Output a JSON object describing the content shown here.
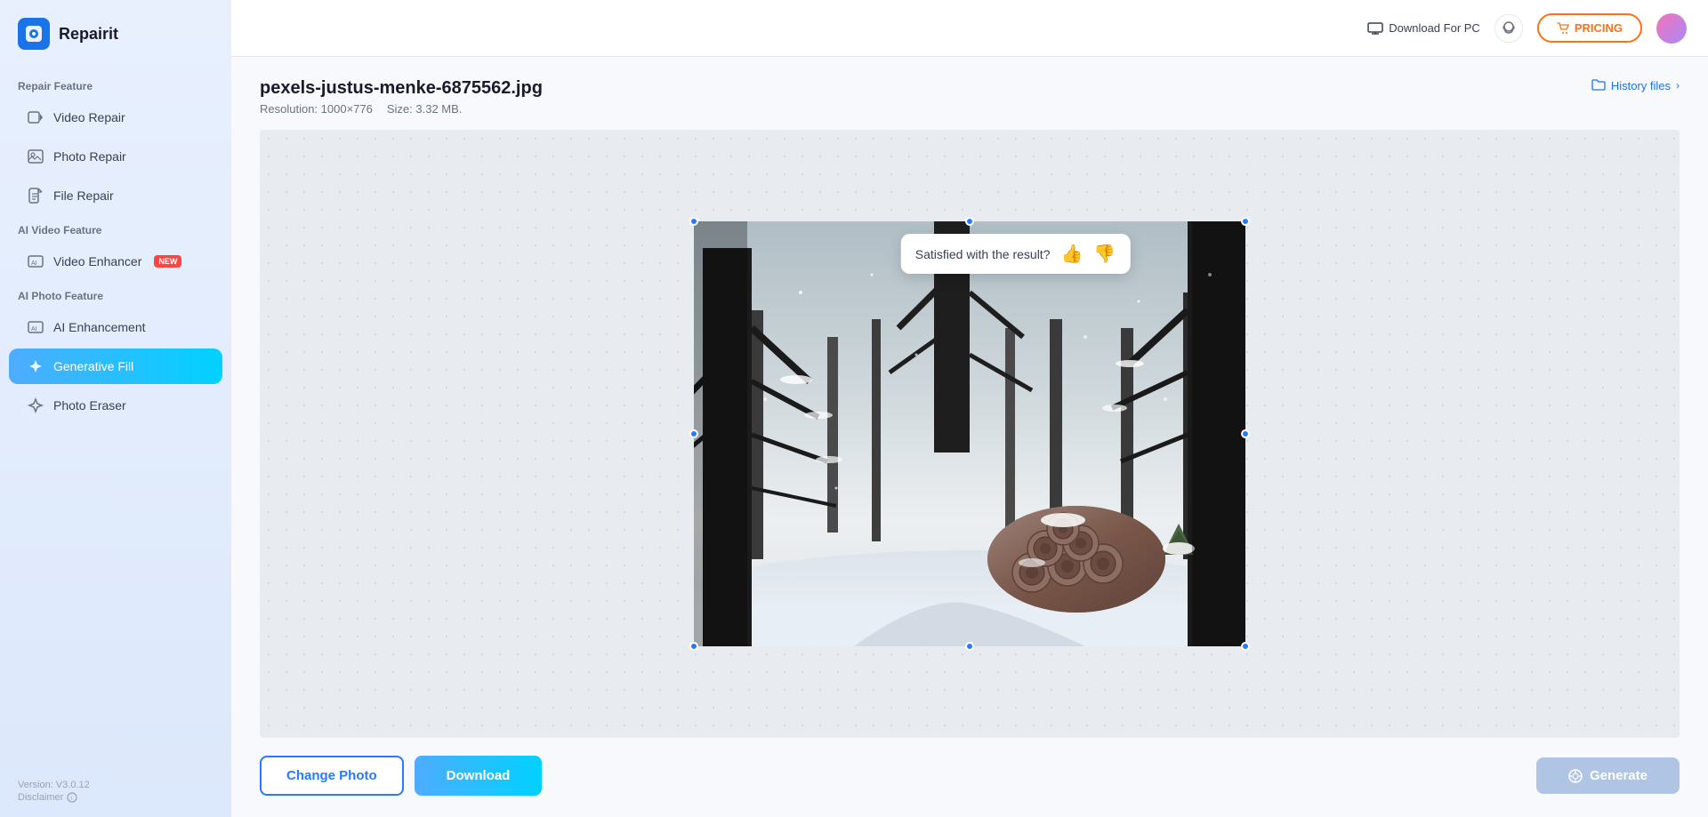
{
  "app": {
    "logo_text": "Repairit",
    "logo_icon": "R"
  },
  "sidebar": {
    "section_repair": "Repair Feature",
    "section_ai_video": "AI Video Feature",
    "section_ai_photo": "AI Photo Feature",
    "items": [
      {
        "id": "video-repair",
        "label": "Video Repair",
        "icon": "▶",
        "active": false
      },
      {
        "id": "photo-repair",
        "label": "Photo Repair",
        "icon": "🖼",
        "active": false
      },
      {
        "id": "file-repair",
        "label": "File Repair",
        "icon": "📄",
        "active": false
      },
      {
        "id": "video-enhancer",
        "label": "Video Enhancer",
        "icon": "🎬",
        "active": false,
        "badge": "NEW"
      },
      {
        "id": "ai-enhancement",
        "label": "AI Enhancement",
        "icon": "✨",
        "active": false
      },
      {
        "id": "generative-fill",
        "label": "Generative Fill",
        "icon": "◇",
        "active": true
      },
      {
        "id": "photo-eraser",
        "label": "Photo Eraser",
        "icon": "◇",
        "active": false
      }
    ],
    "version": "Version: V3.0.12",
    "disclaimer": "Disclaimer"
  },
  "header": {
    "download_pc": "Download For PC",
    "pricing": "PRICING",
    "monitor_icon": "🖥",
    "support_icon": "?"
  },
  "content": {
    "file_name": "pexels-justus-menke-6875562.jpg",
    "resolution_label": "Resolution: 1000×776",
    "size_label": "Size: 3.32 MB.",
    "history_files": "History files",
    "satisfaction_question": "Satisfied with the result?",
    "change_photo_btn": "Change Photo",
    "download_btn": "Download",
    "generate_btn": "Generate",
    "generate_icon": "🔍"
  }
}
